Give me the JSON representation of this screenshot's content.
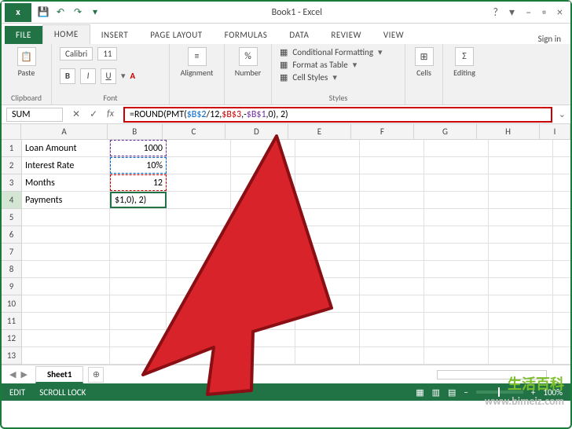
{
  "window": {
    "app_logo_text": "x",
    "title": "Book1 - Excel",
    "help_label": "?",
    "restore_label": "▫",
    "minimize_label": "–",
    "close_label": "×",
    "ribbon_opts_label": "▾"
  },
  "qat": {
    "save": "💾",
    "undo": "↶",
    "redo": "↷",
    "dd": "▾"
  },
  "tabs": {
    "file": "FILE",
    "home": "HOME",
    "insert": "INSERT",
    "pagelayout": "PAGE LAYOUT",
    "formulas": "FORMULAS",
    "data": "DATA",
    "review": "REVIEW",
    "view": "VIEW",
    "signin": "Sign in"
  },
  "ribbon": {
    "clipboard": {
      "label": "Clipboard",
      "paste": "Paste"
    },
    "font": {
      "label": "Font",
      "fontname": "Calibri",
      "fontsize": "11",
      "bold": "B",
      "italic": "I",
      "underline": "U"
    },
    "alignment": {
      "label": "Alignment"
    },
    "number": {
      "label": "Number"
    },
    "styles": {
      "label": "Styles",
      "cond": "Conditional Formatting",
      "table": "Format as Table",
      "cell": "Cell Styles"
    },
    "cells": {
      "label": "Cells"
    },
    "editing": {
      "label": "Editing"
    }
  },
  "formula_bar": {
    "name_box": "SUM",
    "cancel": "✕",
    "enter": "✓",
    "fx": "fx",
    "f_prefix": "=ROUND(PMT(",
    "arg1": "$B$2",
    "slash12": "/12,",
    "arg2": "$B$3",
    "comma_neg": ",-",
    "arg3": "$B$1",
    "comma0": ",0",
    "suffix": "), 2)"
  },
  "grid": {
    "columns": [
      "A",
      "B",
      "C",
      "D",
      "E",
      "F",
      "G",
      "H",
      "I"
    ],
    "rows": [
      "1",
      "2",
      "3",
      "4",
      "5",
      "6",
      "7",
      "8",
      "9",
      "10",
      "11",
      "12",
      "13"
    ],
    "a": {
      "1": "Loan Amount",
      "2": "Interest Rate",
      "3": "Months",
      "4": "Payments"
    },
    "b": {
      "1": "1000",
      "2": "10%",
      "3": "12",
      "4": "$1,0), 2)"
    }
  },
  "sheet_tabs": {
    "sheet1": "Sheet1",
    "new": "⊕"
  },
  "status": {
    "mode": "EDIT",
    "scroll": "SCROLL LOCK",
    "zoom": "100%"
  },
  "watermark": {
    "zh": "生活百科",
    "url": "www.bimeiz.com"
  }
}
